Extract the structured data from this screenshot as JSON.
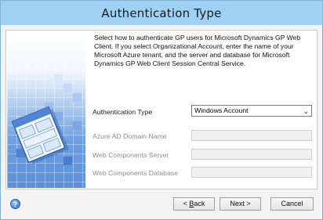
{
  "window": {
    "title": "Authentication Type"
  },
  "description": "Select how to authenticate GP users for Microsoft Dynamics GP Web Client.  If you select Organizational Account, enter the name of your Microsoft Azure tenant, and the server and database for Microsoft Dynamics GP Web Client Session Central Service.",
  "form": {
    "auth_type_label": "Authentication Type",
    "auth_type_value": "Windows Account",
    "azure_domain_label": "Azure AD Domain Name",
    "azure_domain_value": "",
    "web_server_label": "Web Components Server",
    "web_server_value": "",
    "web_db_label": "Web Components Database",
    "web_db_value": ""
  },
  "buttons": {
    "help": "?",
    "back_prefix": "< ",
    "back_mnemonic": "B",
    "back_rest": "ack",
    "next": "Next >",
    "cancel": "Cancel"
  }
}
